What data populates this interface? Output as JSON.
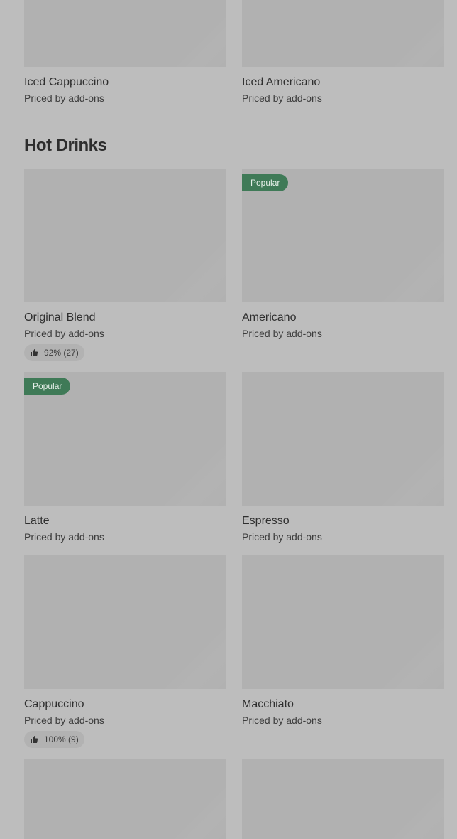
{
  "top_items": [
    {
      "title": "Iced Cappuccino",
      "price": "Priced by add-ons"
    },
    {
      "title": "Iced Americano",
      "price": "Priced by add-ons"
    }
  ],
  "section": {
    "title": "Hot Drinks"
  },
  "items": [
    {
      "title": "Original Blend",
      "price": "Priced by add-ons",
      "badge": "",
      "rating": "92% (27)"
    },
    {
      "title": "Americano",
      "price": "Priced by add-ons",
      "badge": "Popular",
      "rating": ""
    },
    {
      "title": "Latte",
      "price": "Priced by add-ons",
      "badge": "Popular",
      "rating": ""
    },
    {
      "title": "Espresso",
      "price": "Priced by add-ons",
      "badge": "",
      "rating": ""
    },
    {
      "title": "Cappuccino",
      "price": "Priced by add-ons",
      "badge": "",
      "rating": "100% (9)"
    },
    {
      "title": "Macchiato",
      "price": "Priced by add-ons",
      "badge": "",
      "rating": ""
    }
  ],
  "colors": {
    "background": "#bdbdbd",
    "image_placeholder": "#b1b1b1",
    "badge": "#3f7a57"
  },
  "icons": {
    "rating": "thumbs-up-icon"
  }
}
